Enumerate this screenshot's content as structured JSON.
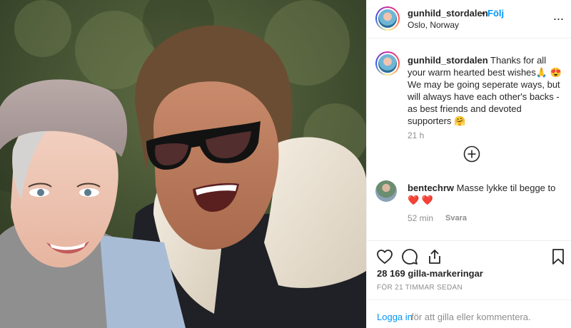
{
  "post": {
    "photo_alt_icon": "photo",
    "header": {
      "username": "gunhild_stordalen",
      "dot": "•",
      "follow_label": "Följ",
      "location": "Oslo, Norway",
      "more_icon": "more-options-icon",
      "more_glyph": "···"
    },
    "caption": {
      "username": "gunhild_stordalen",
      "text": " Thanks for all your warm hearted best wishes🙏 😍  We may be going seperate ways, but will always have each other's backs - as best friends and devoted supporters 🤗",
      "time": "21 h"
    },
    "load_more_icon": "plus-circle-icon",
    "comments": [
      {
        "username": "bentechrw",
        "text": " Masse lykke til begge to❤️ ❤️",
        "time": "52 min",
        "reply_label": "Svara"
      }
    ],
    "actions": {
      "like_icon": "heart-icon",
      "comment_icon": "comment-icon",
      "share_icon": "share-icon",
      "save_icon": "bookmark-icon"
    },
    "likes": "28 169 gilla-markeringar",
    "time_ago": "FÖR 21 TIMMAR SEDAN",
    "login": {
      "link_label": "Logga in",
      "text": " för att gilla eller kommentera."
    }
  },
  "colors": {
    "accent": "#0095f6",
    "text": "#262626",
    "muted": "#8e8e8e",
    "divider": "#efefef",
    "heart": "#ed4956"
  }
}
